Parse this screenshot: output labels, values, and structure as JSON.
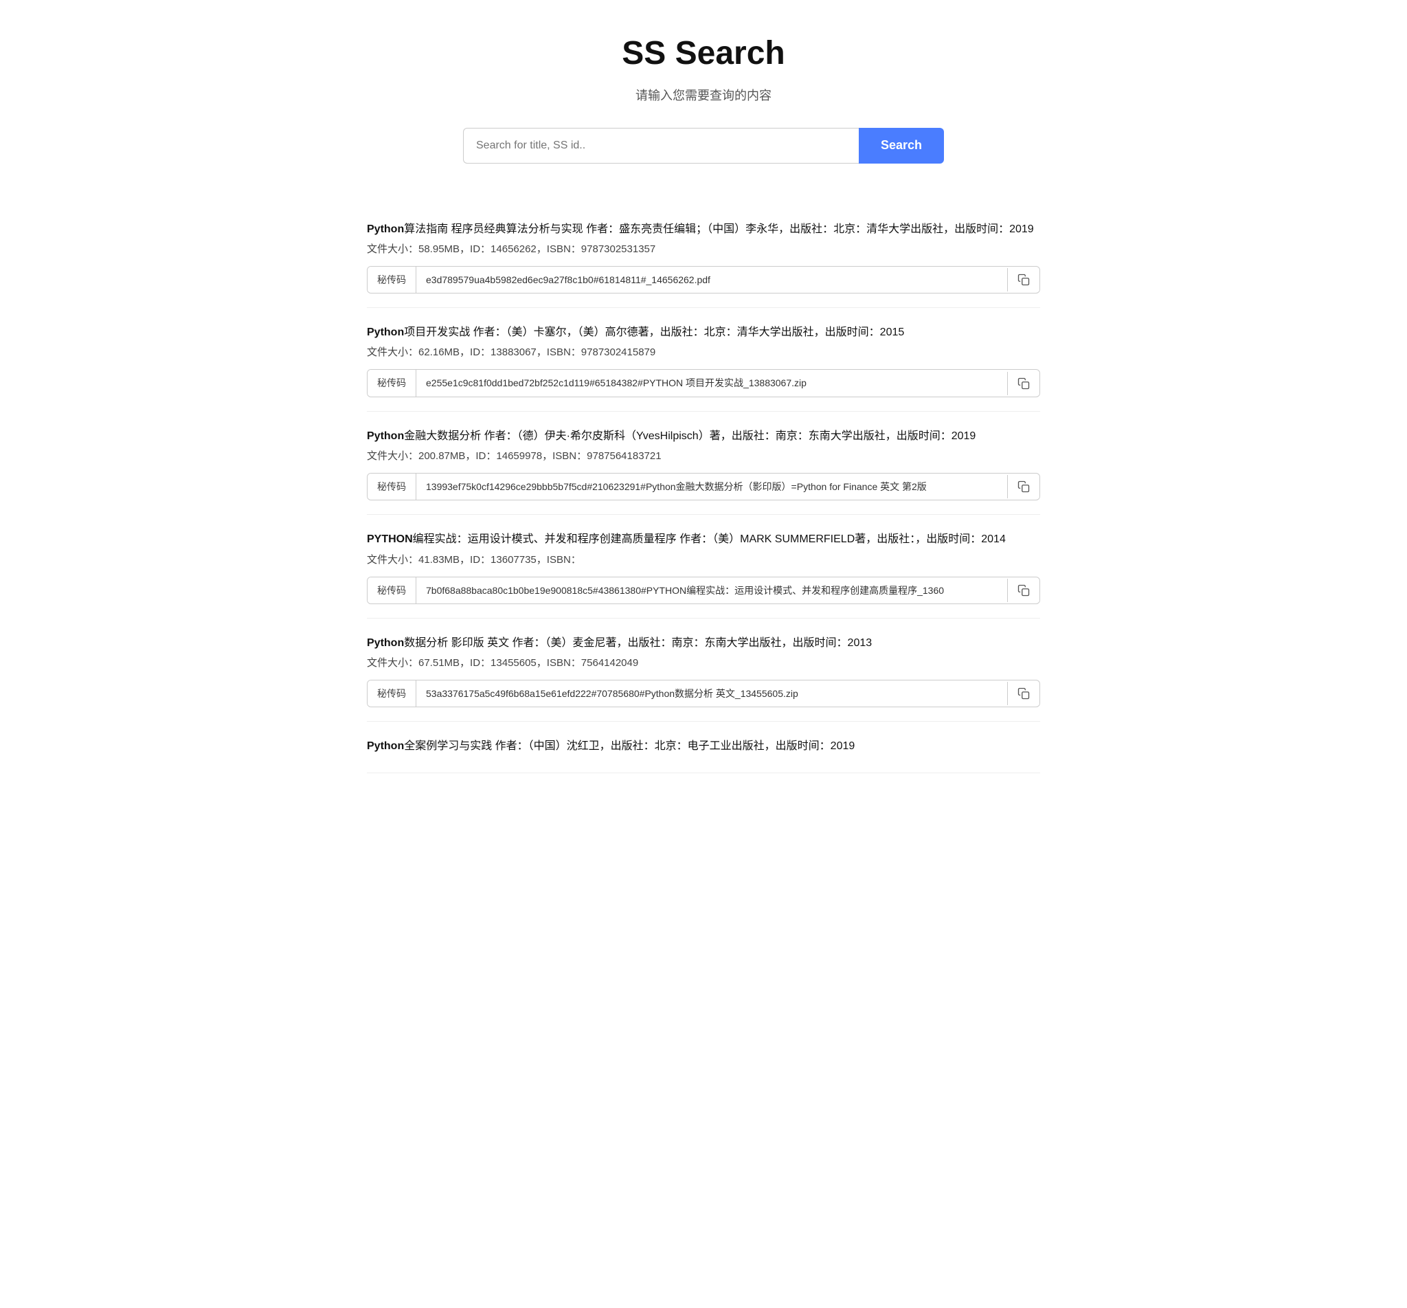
{
  "header": {
    "title": "SS Search",
    "subtitle": "请输入您需要查询的内容"
  },
  "search": {
    "placeholder": "Search for title, SS id..",
    "button_label": "Search",
    "value": ""
  },
  "results": [
    {
      "id": "result-1",
      "title_prefix": "Python",
      "title_rest": "算法指南 程序员经典算法分析与实现 作者：盛东亮责任编辑；（中国）李永华，出版社：北京：清华大学出版社，出版时间：2019",
      "meta": "文件大小：58.95MB，ID：14656262，ISBN：9787302531357",
      "secret_label": "秘传码",
      "secret_value": "e3d789579ua4b5982ed6ec9a27f8c1b0#61814811#_14656262.pdf"
    },
    {
      "id": "result-2",
      "title_prefix": "Python",
      "title_rest": "项目开发实战 作者：（美）卡塞尔，（美）高尔德著，出版社：北京：清华大学出版社，出版时间：2015",
      "meta": "文件大小：62.16MB，ID：13883067，ISBN：9787302415879",
      "secret_label": "秘传码",
      "secret_value": "e255e1c9c81f0dd1bed72bf252c1d119#65184382#PYTHON 项目开发实战_13883067.zip"
    },
    {
      "id": "result-3",
      "title_prefix": "Python",
      "title_rest": "金融大数据分析 作者：（德）伊夫·希尔皮斯科（YvesHilpisch）著，出版社：南京：东南大学出版社，出版时间：2019",
      "meta": "文件大小：200.87MB，ID：14659978，ISBN：9787564183721",
      "secret_label": "秘传码",
      "secret_value": "13993ef75k0cf14296ce29bbb5b7f5cd#210623291#Python金融大数据分析（影印版）=Python for Finance 英文 第2版"
    },
    {
      "id": "result-4",
      "title_prefix": "PYTHON",
      "title_rest": "编程实战：运用设计模式、并发和程序创建高质量程序 作者：（美）MARK SUMMERFIELD著，出版社：，出版时间：2014",
      "meta": "文件大小：41.83MB，ID：13607735，ISBN：",
      "secret_label": "秘传码",
      "secret_value": "7b0f68a88baca80c1b0be19e900818c5#43861380#PYTHON编程实战：运用设计模式、并发和程序创建高质量程序_1360"
    },
    {
      "id": "result-5",
      "title_prefix": "Python",
      "title_rest": "数据分析 影印版 英文 作者：（美）麦金尼著，出版社：南京：东南大学出版社，出版时间：2013",
      "meta": "文件大小：67.51MB，ID：13455605，ISBN：7564142049",
      "secret_label": "秘传码",
      "secret_value": "53a3376175a5c49f6b68a15e61efd222#70785680#Python数据分析 英文_13455605.zip"
    },
    {
      "id": "result-6",
      "title_prefix": "Python",
      "title_rest": "全案例学习与实践 作者：（中国）沈红卫，出版社：北京：电子工业出版社，出版时间：2019",
      "meta": "",
      "secret_label": "",
      "secret_value": ""
    }
  ]
}
